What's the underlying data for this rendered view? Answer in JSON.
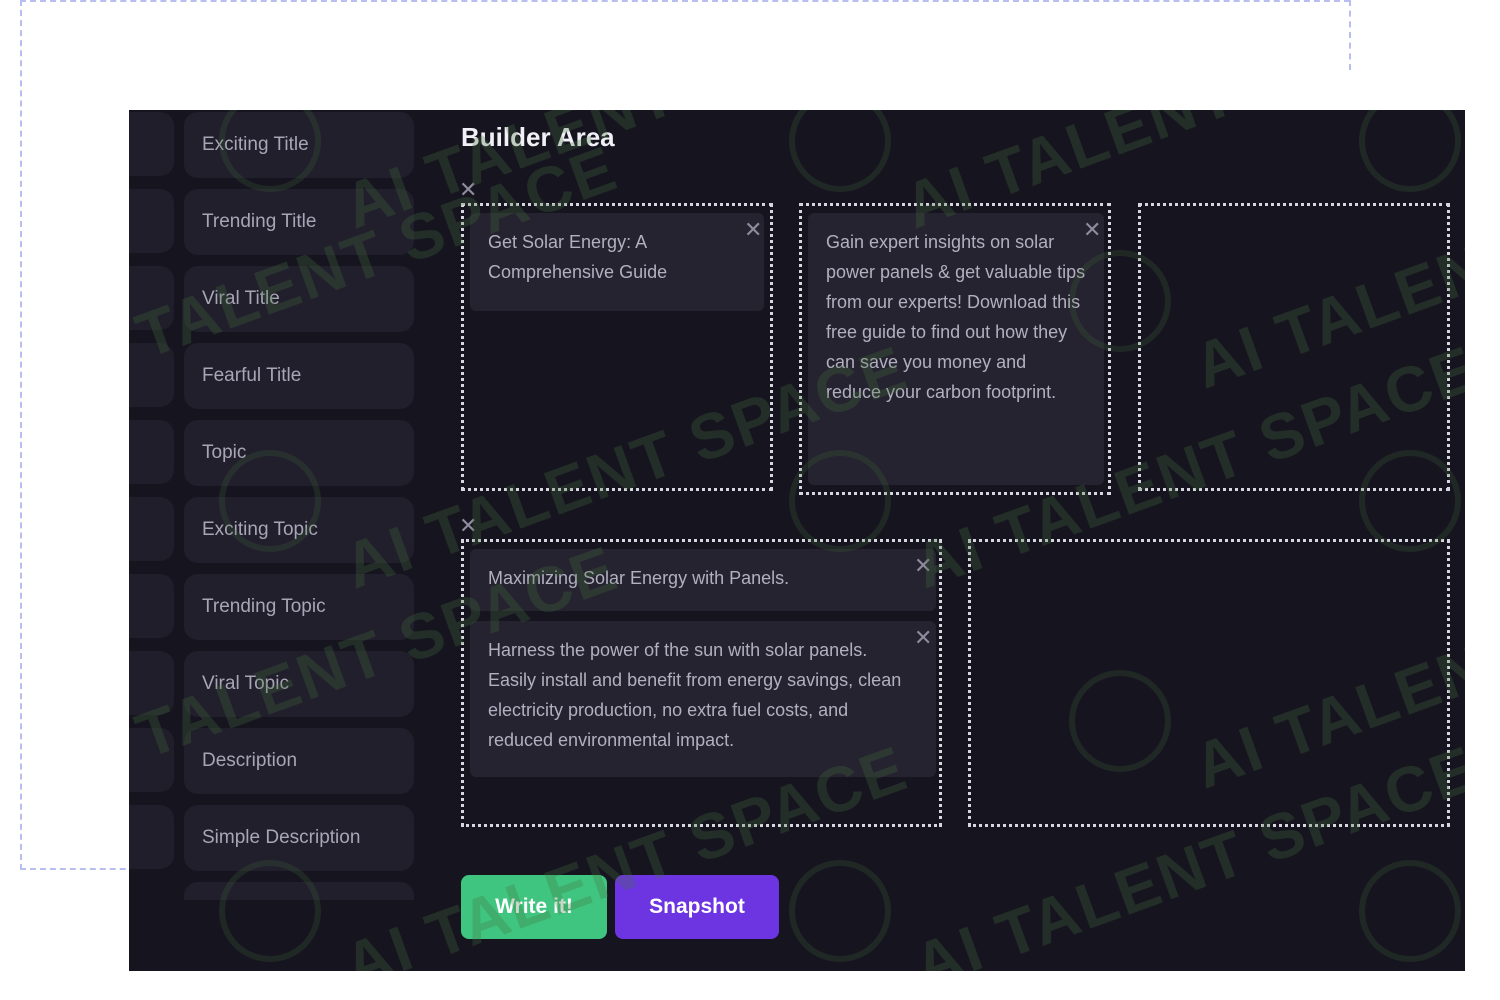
{
  "sidebar": {
    "items": [
      {
        "label": "Exciting Title"
      },
      {
        "label": "Trending Title"
      },
      {
        "label": "Viral Title"
      },
      {
        "label": "Fearful Title"
      },
      {
        "label": "Topic"
      },
      {
        "label": "Exciting Topic"
      },
      {
        "label": "Trending Topic"
      },
      {
        "label": "Viral Topic"
      },
      {
        "label": "Description"
      },
      {
        "label": "Simple Description"
      }
    ]
  },
  "builder": {
    "title": "Builder Area",
    "row1": {
      "card1": "Get Solar Energy: A Comprehensive Guide",
      "card2": "Gain expert insights on solar power panels & get valuable tips from our experts! Download this free guide to find out how they can save you money and reduce your carbon footprint."
    },
    "row2": {
      "card1": "Maximizing Solar Energy with Panels.",
      "card2": "Harness the power of the sun with solar panels. Easily install and benefit from energy savings, clean electricity production, no extra fuel costs, and reduced environmental impact."
    },
    "close_glyph": "✕"
  },
  "actions": {
    "write_label": "Write it!",
    "snapshot_label": "Snapshot"
  },
  "watermark": {
    "text": "AI TALENT SPACE"
  },
  "colors": {
    "app_bg": "#16151f",
    "write_button": "#3fc57f",
    "snapshot_button": "#6d35e2",
    "dropzone_border": "#d7d7df"
  }
}
